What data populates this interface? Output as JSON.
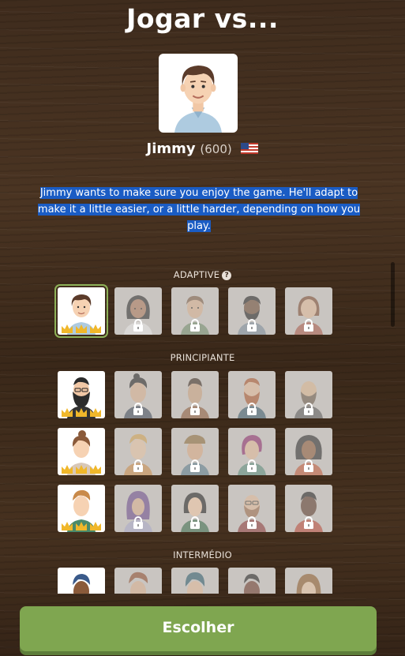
{
  "header": {
    "title": "Jogar vs..."
  },
  "opponent": {
    "name": "Jimmy",
    "rating": "(600)",
    "flag": "us-flag-icon",
    "description": "Jimmy wants to make sure you enjoy the game. He'll adapt to make it a little easier, or a little harder, depending on how you play."
  },
  "sections": {
    "adaptive": "ADAPTIVE",
    "adaptive_help": "?",
    "beginner": "PRINCIPIANTE",
    "intermediate": "INTERMÉDIO"
  },
  "footer": {
    "choose_label": "Escolher"
  },
  "colors": {
    "accent": "#7fa650",
    "selection": "#1a5cc4"
  }
}
